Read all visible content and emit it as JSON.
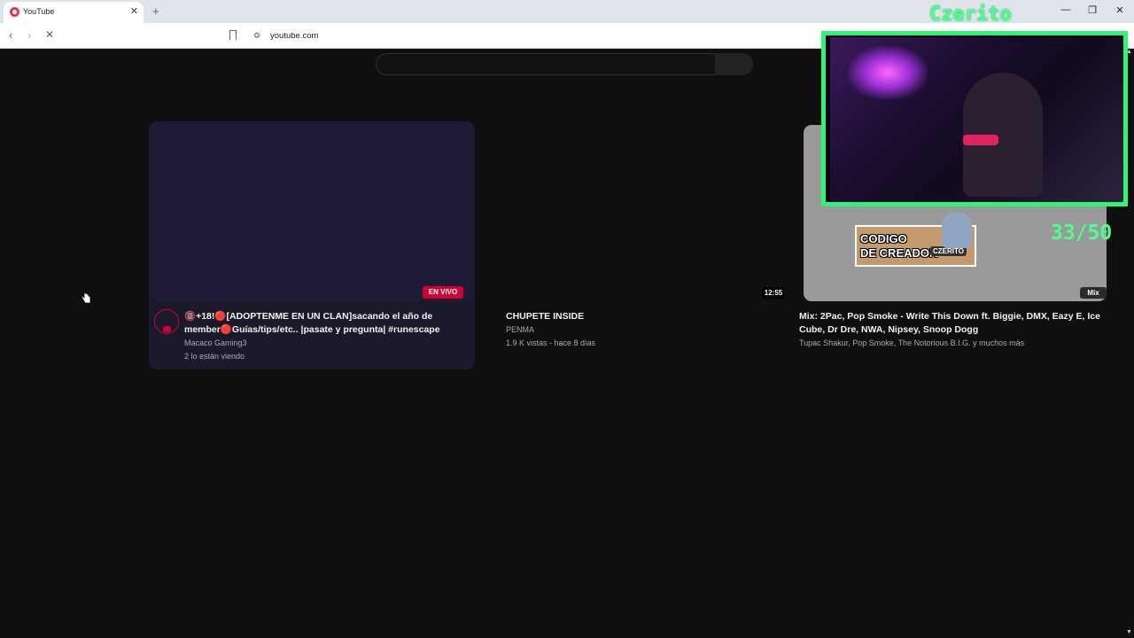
{
  "browser": {
    "tab_title": "YouTube",
    "url": "youtube.com",
    "new_tab_symbol": "+",
    "tab_close_symbol": "✕",
    "controls": {
      "minimize": "—",
      "restore": "❐",
      "close": "✕"
    },
    "nav": {
      "back": "‹",
      "forward": "›",
      "reload": "✕"
    }
  },
  "videos": [
    {
      "title_line1": "🔞+18!🔴[ADOPTENME EN UN CLAN]sacando el año de",
      "title_line2": "member🔴Guías/tips/etc.. |pasate y pregunta| #runescape",
      "channel": "Macaco Gaming3",
      "meta": "2 lo están viendo",
      "badge": "EN VIVO"
    },
    {
      "title": "CHUPETE INSIDE",
      "channel": "PENMA",
      "meta": "1.9 K vistas - hace 8 días",
      "badge": "12:55"
    },
    {
      "title_line1": "Mix: 2Pac, Pop Smoke - Write This Down ft. Biggie, DMX, Eazy E, Ice",
      "title_line2": "Cube, Dr Dre, NWA, Nipsey, Snoop Dogg",
      "channel": "Tupac Shakur, Pop Smoke, The Notorious B.I.G. y muchos más",
      "badge": "Mix"
    }
  ],
  "overlay": {
    "streamer_name": "Czerito",
    "creator_code_label": "CODIGO\nDE CREADOR",
    "creator_code_name": "CZERITO",
    "counter": "33/50"
  },
  "colors": {
    "accent_live": "#cc0033",
    "overlay_green": "#2ef57a",
    "background": "#0f0f0f"
  }
}
